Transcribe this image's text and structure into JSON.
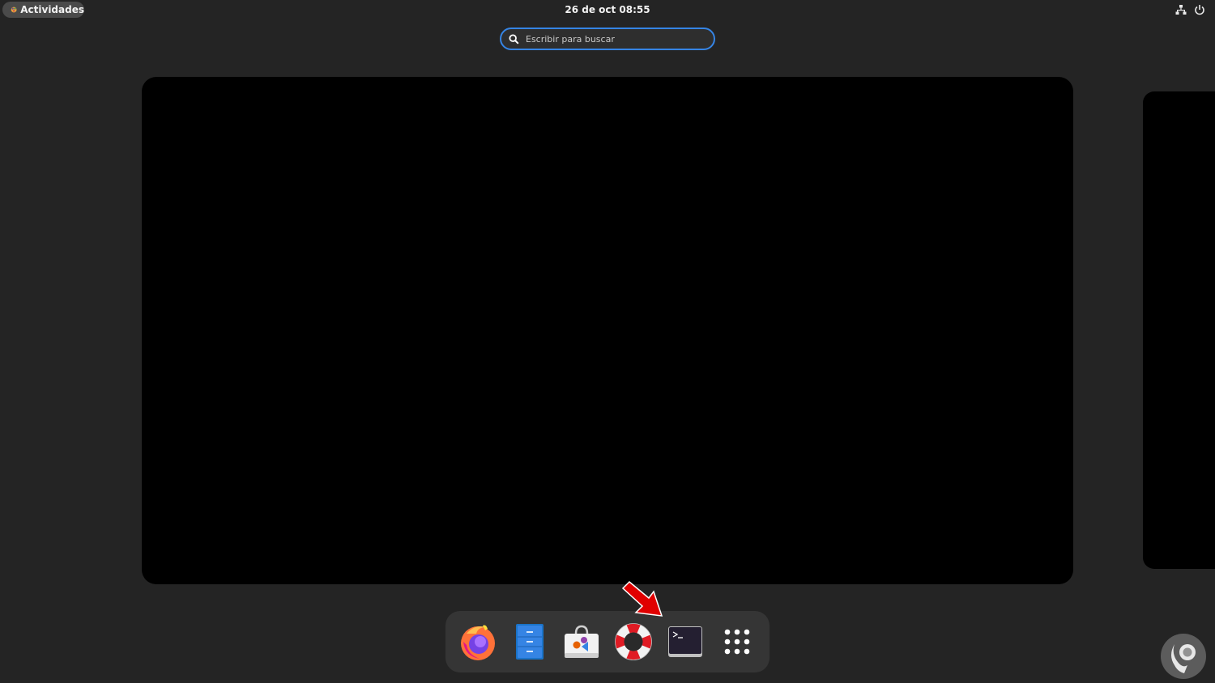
{
  "topbar": {
    "activities_label": "Actividades",
    "clock": "26 de oct  08:55",
    "tray": [
      {
        "icon": "network-wired-icon"
      },
      {
        "icon": "power-icon"
      }
    ]
  },
  "search": {
    "placeholder": "Escribir para buscar",
    "value": ""
  },
  "dock": {
    "items": [
      {
        "name": "Firefox",
        "icon": "firefox-icon"
      },
      {
        "name": "Archivos",
        "icon": "files-icon"
      },
      {
        "name": "Software",
        "icon": "software-store-icon"
      },
      {
        "name": "Ayuda",
        "icon": "help-lifebuoy-icon"
      },
      {
        "name": "Terminal",
        "icon": "terminal-icon"
      },
      {
        "name": "Mostrar aplicaciones",
        "icon": "app-grid-icon"
      }
    ]
  },
  "colors": {
    "background": "#242424",
    "accent": "#3584e4",
    "dock": "#353535",
    "annotation_arrow": "#e00000"
  }
}
